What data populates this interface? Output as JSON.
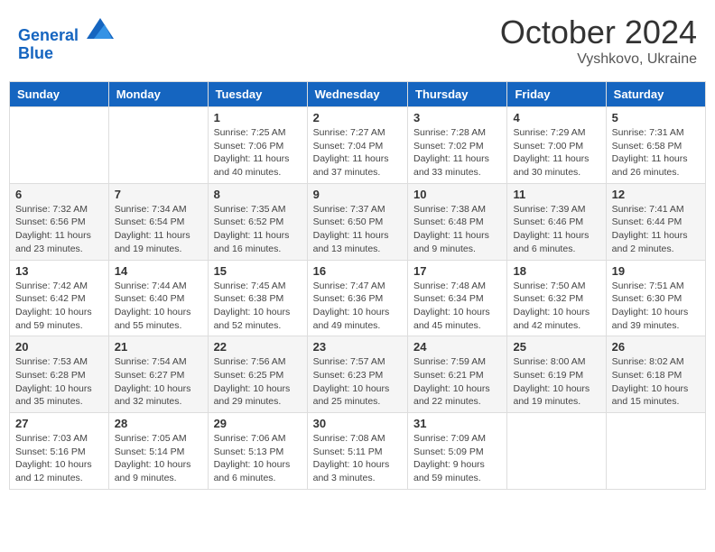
{
  "header": {
    "logo_line1": "General",
    "logo_line2": "Blue",
    "month_title": "October 2024",
    "subtitle": "Vyshkovo, Ukraine"
  },
  "weekdays": [
    "Sunday",
    "Monday",
    "Tuesday",
    "Wednesday",
    "Thursday",
    "Friday",
    "Saturday"
  ],
  "weeks": [
    [
      {
        "day": "",
        "info": ""
      },
      {
        "day": "",
        "info": ""
      },
      {
        "day": "1",
        "info": "Sunrise: 7:25 AM\nSunset: 7:06 PM\nDaylight: 11 hours and 40 minutes."
      },
      {
        "day": "2",
        "info": "Sunrise: 7:27 AM\nSunset: 7:04 PM\nDaylight: 11 hours and 37 minutes."
      },
      {
        "day": "3",
        "info": "Sunrise: 7:28 AM\nSunset: 7:02 PM\nDaylight: 11 hours and 33 minutes."
      },
      {
        "day": "4",
        "info": "Sunrise: 7:29 AM\nSunset: 7:00 PM\nDaylight: 11 hours and 30 minutes."
      },
      {
        "day": "5",
        "info": "Sunrise: 7:31 AM\nSunset: 6:58 PM\nDaylight: 11 hours and 26 minutes."
      }
    ],
    [
      {
        "day": "6",
        "info": "Sunrise: 7:32 AM\nSunset: 6:56 PM\nDaylight: 11 hours and 23 minutes."
      },
      {
        "day": "7",
        "info": "Sunrise: 7:34 AM\nSunset: 6:54 PM\nDaylight: 11 hours and 19 minutes."
      },
      {
        "day": "8",
        "info": "Sunrise: 7:35 AM\nSunset: 6:52 PM\nDaylight: 11 hours and 16 minutes."
      },
      {
        "day": "9",
        "info": "Sunrise: 7:37 AM\nSunset: 6:50 PM\nDaylight: 11 hours and 13 minutes."
      },
      {
        "day": "10",
        "info": "Sunrise: 7:38 AM\nSunset: 6:48 PM\nDaylight: 11 hours and 9 minutes."
      },
      {
        "day": "11",
        "info": "Sunrise: 7:39 AM\nSunset: 6:46 PM\nDaylight: 11 hours and 6 minutes."
      },
      {
        "day": "12",
        "info": "Sunrise: 7:41 AM\nSunset: 6:44 PM\nDaylight: 11 hours and 2 minutes."
      }
    ],
    [
      {
        "day": "13",
        "info": "Sunrise: 7:42 AM\nSunset: 6:42 PM\nDaylight: 10 hours and 59 minutes."
      },
      {
        "day": "14",
        "info": "Sunrise: 7:44 AM\nSunset: 6:40 PM\nDaylight: 10 hours and 55 minutes."
      },
      {
        "day": "15",
        "info": "Sunrise: 7:45 AM\nSunset: 6:38 PM\nDaylight: 10 hours and 52 minutes."
      },
      {
        "day": "16",
        "info": "Sunrise: 7:47 AM\nSunset: 6:36 PM\nDaylight: 10 hours and 49 minutes."
      },
      {
        "day": "17",
        "info": "Sunrise: 7:48 AM\nSunset: 6:34 PM\nDaylight: 10 hours and 45 minutes."
      },
      {
        "day": "18",
        "info": "Sunrise: 7:50 AM\nSunset: 6:32 PM\nDaylight: 10 hours and 42 minutes."
      },
      {
        "day": "19",
        "info": "Sunrise: 7:51 AM\nSunset: 6:30 PM\nDaylight: 10 hours and 39 minutes."
      }
    ],
    [
      {
        "day": "20",
        "info": "Sunrise: 7:53 AM\nSunset: 6:28 PM\nDaylight: 10 hours and 35 minutes."
      },
      {
        "day": "21",
        "info": "Sunrise: 7:54 AM\nSunset: 6:27 PM\nDaylight: 10 hours and 32 minutes."
      },
      {
        "day": "22",
        "info": "Sunrise: 7:56 AM\nSunset: 6:25 PM\nDaylight: 10 hours and 29 minutes."
      },
      {
        "day": "23",
        "info": "Sunrise: 7:57 AM\nSunset: 6:23 PM\nDaylight: 10 hours and 25 minutes."
      },
      {
        "day": "24",
        "info": "Sunrise: 7:59 AM\nSunset: 6:21 PM\nDaylight: 10 hours and 22 minutes."
      },
      {
        "day": "25",
        "info": "Sunrise: 8:00 AM\nSunset: 6:19 PM\nDaylight: 10 hours and 19 minutes."
      },
      {
        "day": "26",
        "info": "Sunrise: 8:02 AM\nSunset: 6:18 PM\nDaylight: 10 hours and 15 minutes."
      }
    ],
    [
      {
        "day": "27",
        "info": "Sunrise: 7:03 AM\nSunset: 5:16 PM\nDaylight: 10 hours and 12 minutes."
      },
      {
        "day": "28",
        "info": "Sunrise: 7:05 AM\nSunset: 5:14 PM\nDaylight: 10 hours and 9 minutes."
      },
      {
        "day": "29",
        "info": "Sunrise: 7:06 AM\nSunset: 5:13 PM\nDaylight: 10 hours and 6 minutes."
      },
      {
        "day": "30",
        "info": "Sunrise: 7:08 AM\nSunset: 5:11 PM\nDaylight: 10 hours and 3 minutes."
      },
      {
        "day": "31",
        "info": "Sunrise: 7:09 AM\nSunset: 5:09 PM\nDaylight: 9 hours and 59 minutes."
      },
      {
        "day": "",
        "info": ""
      },
      {
        "day": "",
        "info": ""
      }
    ]
  ]
}
